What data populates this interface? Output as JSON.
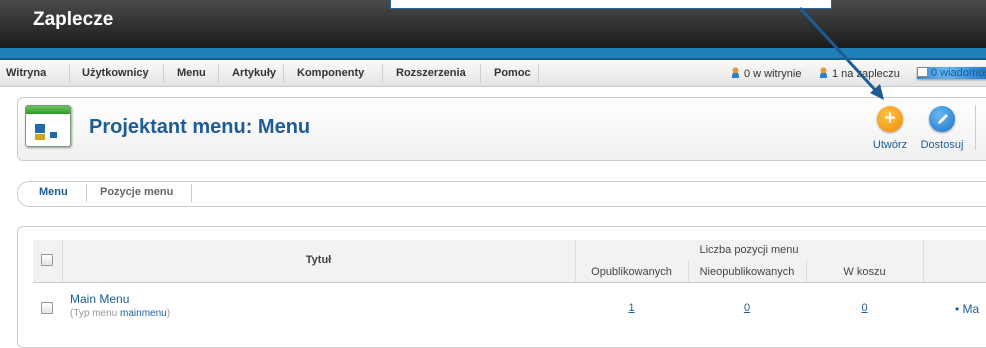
{
  "header": {
    "title": "Zaplecze"
  },
  "menubar": {
    "items": [
      "Witryna",
      "Użytkownicy",
      "Menu",
      "Artykuły",
      "Komponenty",
      "Rozszerzenia",
      "Pomoc"
    ]
  },
  "status": {
    "site": "0 w witrynie",
    "backend": "1 na zapleczu",
    "messages": "0 wiadomoś"
  },
  "toolbar": {
    "page_title": "Projektant menu: Menu",
    "create_label": "Utwórz",
    "options_label": "Dostosuj"
  },
  "subtabs": {
    "menu": "Menu",
    "items": "Pozycje menu"
  },
  "table": {
    "col_title": "Tytuł",
    "group_header": "Liczba pozycji menu",
    "col_published": "Opublikowanych",
    "col_unpublished": "Nieopublikowanych",
    "col_trashed": "W koszu",
    "rows": [
      {
        "title": "Main Menu",
        "type_prefix": "(Typ menu ",
        "type_value": "mainmenu",
        "type_suffix": ")",
        "published": "1",
        "unpublished": "0",
        "trashed": "0",
        "modules": "Ma"
      }
    ]
  },
  "colors": {
    "accent": "#1d5c95",
    "header": "#1b1b1b",
    "stripe": "#1f7fb8"
  }
}
